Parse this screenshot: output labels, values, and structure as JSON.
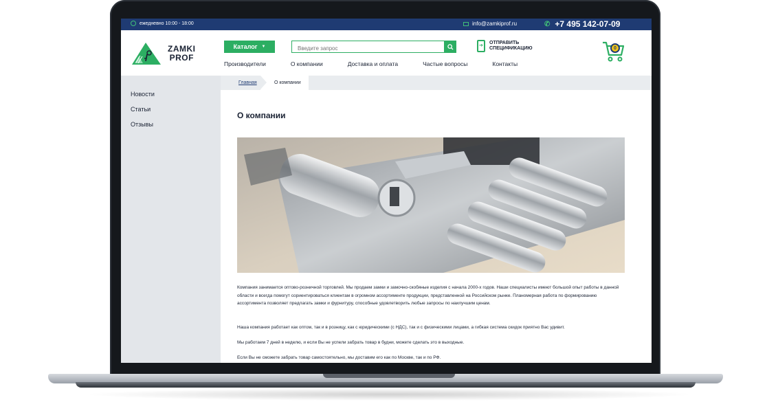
{
  "topbar": {
    "hours": "ежедневно 10:00 - 18:00",
    "email": "info@zamkiprof.ru",
    "phone": "+7 495 142-07-09"
  },
  "logo": {
    "line1": "ZAMKI",
    "line2": "PROF"
  },
  "catalog_button": "Каталог",
  "search": {
    "placeholder": "Введите запрос"
  },
  "spec": {
    "line1": "ОТПРАВИТЬ",
    "line2": "СПЕЦИФИКАЦИЮ"
  },
  "cart": {
    "count": "0"
  },
  "nav": [
    "Производители",
    "О компании",
    "Доставка и оплата",
    "Частые вопросы",
    "Контакты"
  ],
  "sidebar": [
    "Новости",
    "Статьи",
    "Отзывы"
  ],
  "breadcrumb": {
    "home": "Главная",
    "current": "О компании"
  },
  "page_title": "О компании",
  "paragraphs": [
    "Компания занимается оптово-розничной торговлей. Мы продаем замки и замочно-скобяные изделия с начала 2000-х годов. Наши специалисты имеют большой опыт работы в данной области и всегда помогут сориентироваться клиентам в огромном ассортименте продукции, представленной на Российском рынке. Планомерная работа по формированию ассортимента позволяет предлагать замки и фурнитуру, способные удовлетворить любые запросы по наилучшим ценам.",
    "Наша компания работает как оптом, так и в розницу, как с юридическими (с НДС), так и с физическими лицами, а гибкая система скидок приятно Вас удивит.",
    "Мы работаем 7 дней в неделю, и если Вы не успели забрать товар в будни, можете сделать это в выходные.",
    "Если Вы не сможете забрать товар самостоятельно, мы доставим его как по Москве, так и по РФ."
  ],
  "colors": {
    "topbar": "#1f3b73",
    "accent": "#2cae62",
    "sidebar": "#e3e6ea"
  }
}
